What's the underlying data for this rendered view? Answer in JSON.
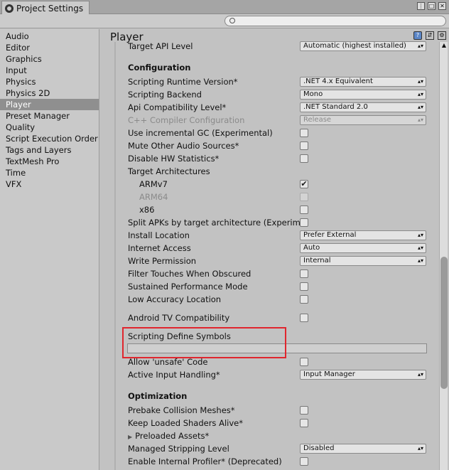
{
  "window": {
    "title": "Project Settings"
  },
  "sidebar": {
    "items": [
      "Audio",
      "Editor",
      "Graphics",
      "Input",
      "Physics",
      "Physics 2D",
      "Player",
      "Preset Manager",
      "Quality",
      "Script Execution Order",
      "Tags and Layers",
      "TextMesh Pro",
      "Time",
      "VFX"
    ],
    "active": "Player"
  },
  "header": {
    "title": "Player"
  },
  "settings": {
    "target_api_label": "Target API Level",
    "target_api_value": "Automatic (highest installed)",
    "configuration": "Configuration",
    "runtime_label": "Scripting Runtime Version*",
    "runtime_value": ".NET 4.x Equivalent",
    "backend_label": "Scripting Backend",
    "backend_value": "Mono",
    "api_compat_label": "Api Compatibility Level*",
    "api_compat_value": ".NET Standard 2.0",
    "cpp_label": "C++ Compiler Configuration",
    "cpp_value": "Release",
    "incremental_gc": "Use incremental GC (Experimental)",
    "mute_audio": "Mute Other Audio Sources*",
    "disable_hw": "Disable HW Statistics*",
    "target_arch": "Target Architectures",
    "armv7": "ARMv7",
    "arm64": "ARM64",
    "x86": "x86",
    "split_apks": "Split APKs by target architecture (Experim",
    "install_location_label": "Install Location",
    "install_location_value": "Prefer External",
    "internet_access_label": "Internet Access",
    "internet_access_value": "Auto",
    "write_permission_label": "Write Permission",
    "write_permission_value": "Internal",
    "filter_touches": "Filter Touches When Obscured",
    "sustained_perf": "Sustained Performance Mode",
    "low_accuracy": "Low Accuracy Location",
    "android_tv": "Android TV Compatibility",
    "define_symbols": "Scripting Define Symbols",
    "allow_unsafe": "Allow 'unsafe' Code",
    "active_input_label": "Active Input Handling*",
    "active_input_value": "Input Manager",
    "optimization": "Optimization",
    "prebake": "Prebake Collision Meshes*",
    "keep_shaders": "Keep Loaded Shaders Alive*",
    "preloaded_assets": "Preloaded Assets*",
    "stripping_label": "Managed Stripping Level",
    "stripping_value": "Disabled",
    "internal_profiler": "Enable Internal Profiler* (Deprecated)"
  },
  "checks": {
    "armv7": true
  },
  "colors": {
    "highlight": "#e0262e",
    "active_item": "#8f8f8f"
  }
}
